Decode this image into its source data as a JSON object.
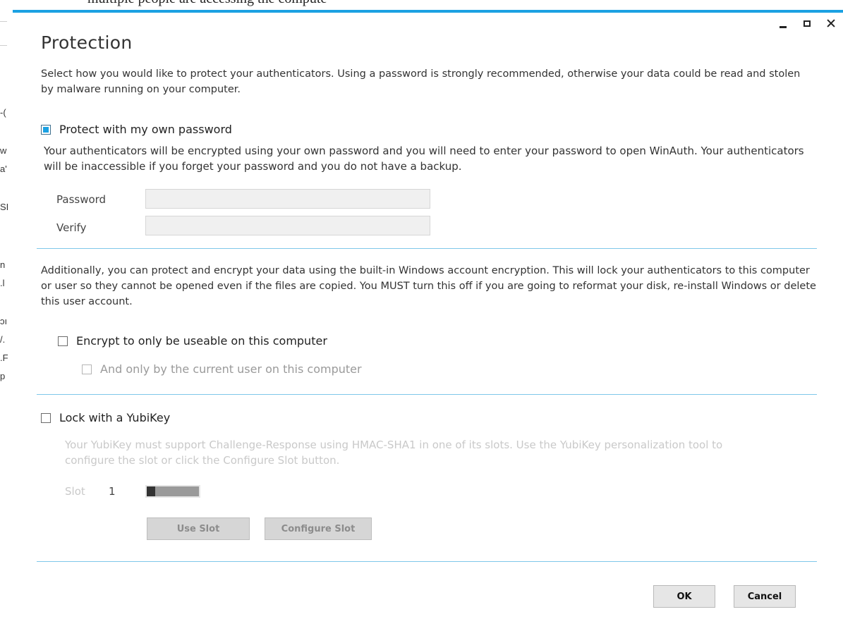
{
  "background": {
    "top_text": "multiple people are accessing the compute",
    "left_fragments": [
      "-(",
      "w",
      "a'",
      "SI",
      "n",
      ".l",
      "ɔı",
      "/.",
      ".F",
      "p"
    ]
  },
  "window": {
    "minimize_icon": "minimize-icon",
    "maximize_icon": "maximize-icon",
    "close_icon": "close-icon",
    "accent_color": "#1ba1e2"
  },
  "dialog": {
    "title": "Protection",
    "intro": "Select how you would like to protect your authenticators. Using a password is strongly recommended, otherwise your data could be read and stolen by malware running on your computer.",
    "password_option": {
      "label": "Protect with my own password",
      "checked": true,
      "description": "Your authenticators will be encrypted using your own password and you will need to enter your password to open WinAuth. Your authenticators will be inaccessible if you forget your password and you do not have a backup."
    },
    "fields": {
      "password_label": "Password",
      "password_value": "",
      "verify_label": "Verify",
      "verify_value": ""
    },
    "windows_encryption": {
      "description": "Additionally, you can protect and encrypt your data using the built-in Windows account encryption. This will lock your authenticators to this computer or user so they cannot be opened even if the files are copied. You MUST turn this off if you are going to reformat your disk, re-install Windows or delete this user account.",
      "computer_option": {
        "label": "Encrypt to only be useable on this computer",
        "checked": false
      },
      "user_option": {
        "label": "And only by the current user on this computer",
        "checked": false,
        "disabled": true
      }
    },
    "yubikey": {
      "option": {
        "label": "Lock with a YubiKey",
        "checked": false
      },
      "description": "Your YubiKey must support Challenge-Response using HMAC-SHA1 in one of its slots. Use the YubiKey personalization tool to configure the slot or click the Configure Slot button.",
      "slot_label": "Slot",
      "slot_value": "1",
      "use_slot_label": "Use Slot",
      "configure_slot_label": "Configure Slot"
    },
    "ok_label": "OK",
    "cancel_label": "Cancel"
  }
}
